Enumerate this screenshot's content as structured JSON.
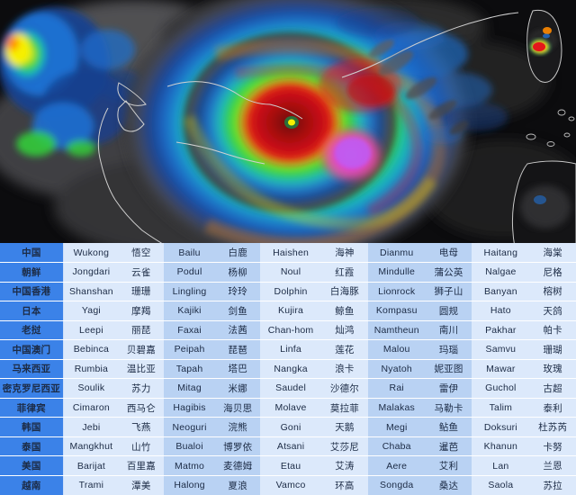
{
  "satellite": {
    "description": "infrared-enhanced satellite image of a mature typhoon with a clear eye west of Taiwan",
    "colors": {
      "background": "#0b0b0c",
      "cloud_gray": "#6e6e70",
      "cold_blue": "#1f6fd0",
      "green": "#33d43a",
      "yellow": "#f7f000",
      "orange": "#ff8a00",
      "red": "#e5161b",
      "dark_red": "#8c0d10",
      "magenta": "#e23ce0",
      "violet": "#9b5cf0",
      "coastline": "#d8d8d8"
    },
    "eye_label": "storm-eye"
  },
  "table": {
    "columns": [
      "country",
      "name1_en",
      "name1_cn",
      "name2_en",
      "name2_cn",
      "name3_en",
      "name3_cn",
      "name4_en",
      "name4_cn",
      "name5_en",
      "name5_cn"
    ],
    "rows": [
      {
        "country": "中国",
        "cells": [
          "Wukong",
          "悟空",
          "Bailu",
          "白鹿",
          "Haishen",
          "海神",
          "Dianmu",
          "电母",
          "Haitang",
          "海棠"
        ]
      },
      {
        "country": "朝鲜",
        "cells": [
          "Jongdari",
          "云雀",
          "Podul",
          "杨柳",
          "Noul",
          "红霞",
          "Mindulle",
          "蒲公英",
          "Nalgae",
          "尼格"
        ]
      },
      {
        "country": "中国香港",
        "cells": [
          "Shanshan",
          "珊珊",
          "Lingling",
          "玲玲",
          "Dolphin",
          "白海豚",
          "Lionrock",
          "狮子山",
          "Banyan",
          "榕树"
        ]
      },
      {
        "country": "日本",
        "cells": [
          "Yagi",
          "摩羯",
          "Kajiki",
          "剑鱼",
          "Kujira",
          "鲸鱼",
          "Kompasu",
          "圆规",
          "Hato",
          "天鸽"
        ]
      },
      {
        "country": "老挝",
        "cells": [
          "Leepi",
          "丽琵",
          "Faxai",
          "法茜",
          "Chan-hom",
          "灿鸿",
          "Namtheun",
          "南川",
          "Pakhar",
          "帕卡"
        ]
      },
      {
        "country": "中国澳门",
        "cells": [
          "Bebinca",
          "贝碧嘉",
          "Peipah",
          "琵琶",
          "Linfa",
          "莲花",
          "Malou",
          "玛瑙",
          "Samvu",
          "珊瑚"
        ]
      },
      {
        "country": "马来西亚",
        "cells": [
          "Rumbia",
          "温比亚",
          "Tapah",
          "塔巴",
          "Nangka",
          "浪卡",
          "Nyatoh",
          "妮亚图",
          "Mawar",
          "玫瑰"
        ]
      },
      {
        "country": "密克罗尼西亚",
        "cells": [
          "Soulik",
          "苏力",
          "Mitag",
          "米娜",
          "Saudel",
          "沙德尔",
          "Rai",
          "雷伊",
          "Guchol",
          "古超"
        ]
      },
      {
        "country": "菲律宾",
        "cells": [
          "Cimaron",
          "西马仑",
          "Hagibis",
          "海贝思",
          "Molave",
          "莫拉菲",
          "Malakas",
          "马勒卡",
          "Talim",
          "泰利"
        ]
      },
      {
        "country": "韩国",
        "cells": [
          "Jebi",
          "飞燕",
          "Neoguri",
          "浣熊",
          "Goni",
          "天鹅",
          "Megi",
          "鲇鱼",
          "Doksuri",
          "杜苏芮"
        ]
      },
      {
        "country": "泰国",
        "cells": [
          "Mangkhut",
          "山竹",
          "Bualoi",
          "博罗依",
          "Atsani",
          "艾莎尼",
          "Chaba",
          "暹芭",
          "Khanun",
          "卡努"
        ]
      },
      {
        "country": "美国",
        "cells": [
          "Barijat",
          "百里嘉",
          "Matmo",
          "麦德姆",
          "Etau",
          "艾涛",
          "Aere",
          "艾利",
          "Lan",
          "兰恩"
        ]
      },
      {
        "country": "越南",
        "cells": [
          "Trami",
          "潭美",
          "Halong",
          "夏浪",
          "Vamco",
          "环高",
          "Songda",
          "桑达",
          "Saola",
          "苏拉"
        ]
      }
    ]
  }
}
